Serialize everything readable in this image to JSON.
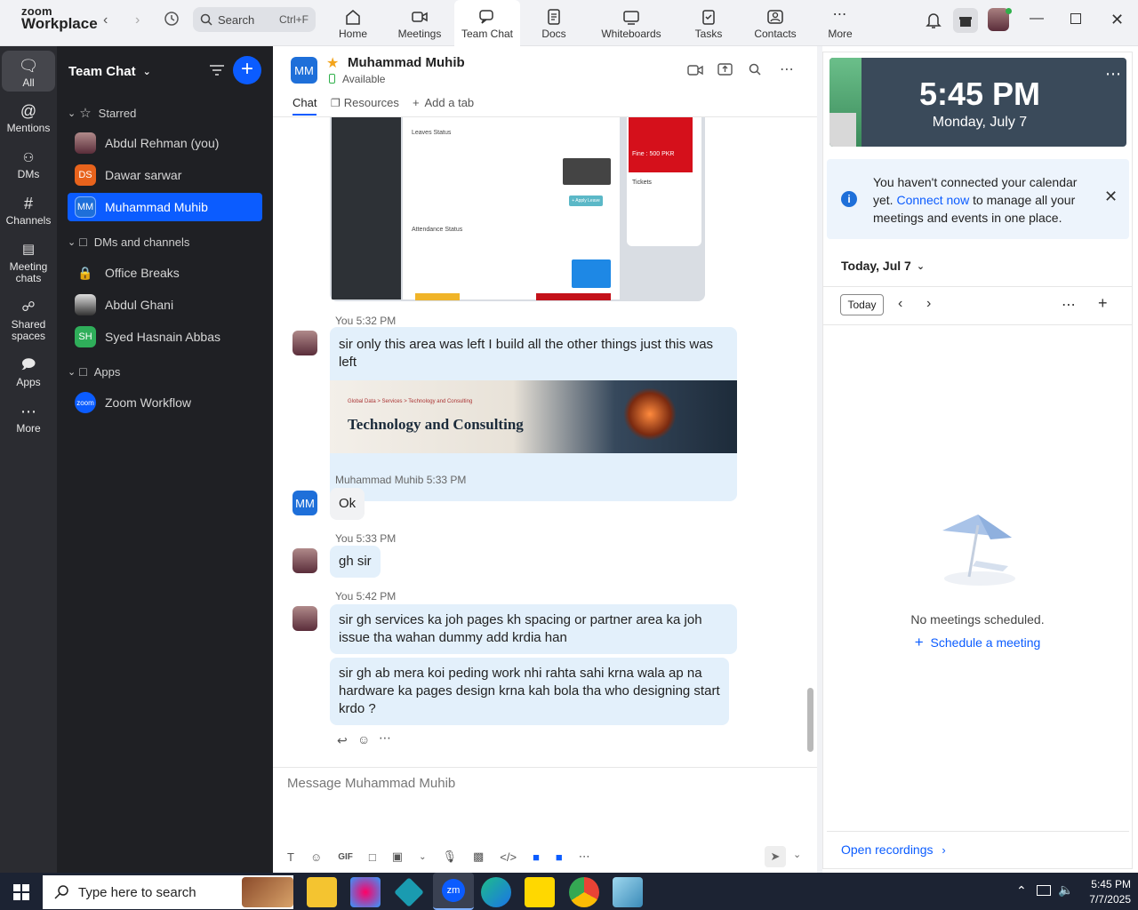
{
  "app": {
    "logo_line1": "zoom",
    "logo_line2": "Workplace"
  },
  "topbar": {
    "search_label": "Search",
    "search_shortcut": "Ctrl+F",
    "tabs": [
      {
        "label": "Home",
        "icon": "home-icon"
      },
      {
        "label": "Meetings",
        "icon": "video-icon"
      },
      {
        "label": "Team Chat",
        "icon": "chat-icon"
      },
      {
        "label": "Docs",
        "icon": "doc-icon"
      },
      {
        "label": "Whiteboards",
        "icon": "whiteboard-icon"
      },
      {
        "label": "Tasks",
        "icon": "tasks-icon"
      },
      {
        "label": "Contacts",
        "icon": "contacts-icon"
      },
      {
        "label": "More",
        "icon": "more-icon"
      }
    ],
    "active_tab": "Team Chat"
  },
  "rail": {
    "items": [
      {
        "label": "All",
        "icon": "chat-bubble-icon"
      },
      {
        "label": "Mentions",
        "icon": "at-icon"
      },
      {
        "label": "DMs",
        "icon": "people-icon"
      },
      {
        "label": "Channels",
        "icon": "hash-icon"
      },
      {
        "label": "Meeting chats",
        "icon": "calendar-icon"
      },
      {
        "label": "Shared spaces",
        "icon": "share-icon"
      },
      {
        "label": "Apps",
        "icon": "apps-icon"
      },
      {
        "label": "More",
        "icon": "more-icon"
      }
    ]
  },
  "sidebar": {
    "title": "Team Chat",
    "starred_label": "Starred",
    "starred": [
      {
        "name": "Abdul Rehman (you)",
        "initials": "",
        "color": "#6b3a3a"
      },
      {
        "name": "Dawar sarwar",
        "initials": "DS",
        "color": "#e8631c"
      },
      {
        "name": "Muhammad Muhib",
        "initials": "MM",
        "color": "#1e6fd9"
      }
    ],
    "dms_label": "DMs and channels",
    "dms": [
      {
        "name": "Office Breaks",
        "initials": "",
        "color": ""
      },
      {
        "name": "Abdul Ghani",
        "initials": "",
        "color": "#333"
      },
      {
        "name": "Syed Hasnain Abbas",
        "initials": "SH",
        "color": "#2fae5a"
      }
    ],
    "apps_label": "Apps",
    "apps": [
      {
        "name": "Zoom Workflow",
        "initials": "zoom",
        "color": "#0b5cff"
      }
    ]
  },
  "chat": {
    "contact_initials": "MM",
    "contact_name": "Muhammad Muhib",
    "status": "Available",
    "tabs": {
      "chat": "Chat",
      "resources": "Resources",
      "add": "Add a tab"
    },
    "screenshot_texts": {
      "leaves": "Leaves Status",
      "attendance": "Attendance Status",
      "fine": "Fine : 500 PKR",
      "tickets": "Tickets",
      "apply": "+ Apply Leave"
    },
    "messages": [
      {
        "sender": "You",
        "time": "5:32 PM",
        "text": "sir only this area was left  I build all the other things just this was left",
        "image_text": "Technology and Consulting",
        "image_crumb": "Global Data  >  Services  >  Technology and Consulting"
      },
      {
        "sender": "Muhammad Muhib",
        "time": "5:33 PM",
        "text": "Ok"
      },
      {
        "sender": "You",
        "time": "5:33 PM",
        "text": "gh sir"
      },
      {
        "sender": "You",
        "time": "5:42 PM",
        "text": "sir gh services ka joh pages kh spacing or partner area ka joh issue tha wahan dummy add krdia han"
      },
      {
        "sender": "",
        "time": "",
        "text": "sir gh ab mera koi peding work nhi rahta sahi krna wala ap na hardware ka pages design krna kah bola tha who designing start krdo ?"
      }
    ],
    "composer_placeholder": "Message Muhammad Muhib",
    "composer_gif": "GIF"
  },
  "calendar": {
    "time": "5:45 PM",
    "date": "Monday, July 7",
    "notice_pre": "You haven't connected your calendar yet.",
    "notice_link": "Connect now",
    "notice_post": "to manage all your meetings and events in one place.",
    "today_label": "Today, Jul 7",
    "today_btn": "Today",
    "empty": "No meetings scheduled.",
    "schedule": "Schedule a meeting",
    "recordings": "Open recordings"
  },
  "taskbar": {
    "search": "Type here to search",
    "time": "5:45 PM",
    "date": "7/7/2025"
  }
}
